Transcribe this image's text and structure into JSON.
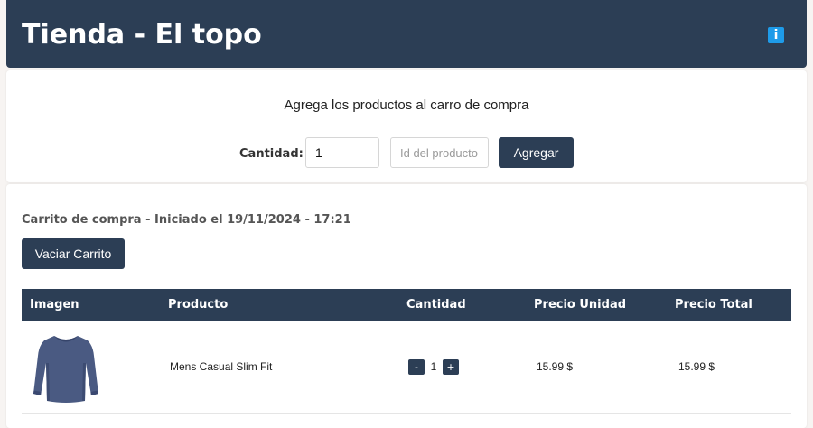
{
  "header": {
    "title": "Tienda - El topo",
    "info_icon": "info-icon",
    "info_glyph": "i"
  },
  "add_form": {
    "instruction": "Agrega los productos al carro de compra",
    "quantity_label": "Cantidad:",
    "quantity_value": "1",
    "product_id_placeholder": "Id del producto",
    "product_id_value": "",
    "add_button": "Agregar"
  },
  "cart": {
    "title": "Carrito de compra - Iniciado el 19/11/2024 - 17:21",
    "empty_button": "Vaciar Carrito",
    "columns": [
      "Imagen",
      "Producto",
      "Cantidad",
      "Precio Unidad",
      "Precio Total"
    ],
    "items": [
      {
        "image_icon": "long-sleeve-shirt-image",
        "product": "Mens Casual Slim Fit",
        "quantity": "1",
        "decrement_label": "-",
        "increment_label": "+",
        "unit_price": "15.99 $",
        "total_price": "15.99 $"
      }
    ]
  },
  "colors": {
    "primary_dark": "#2c3e55",
    "info_blue": "#1e9be9",
    "background": "#f7f4f2",
    "shirt": "#4a5a82"
  }
}
